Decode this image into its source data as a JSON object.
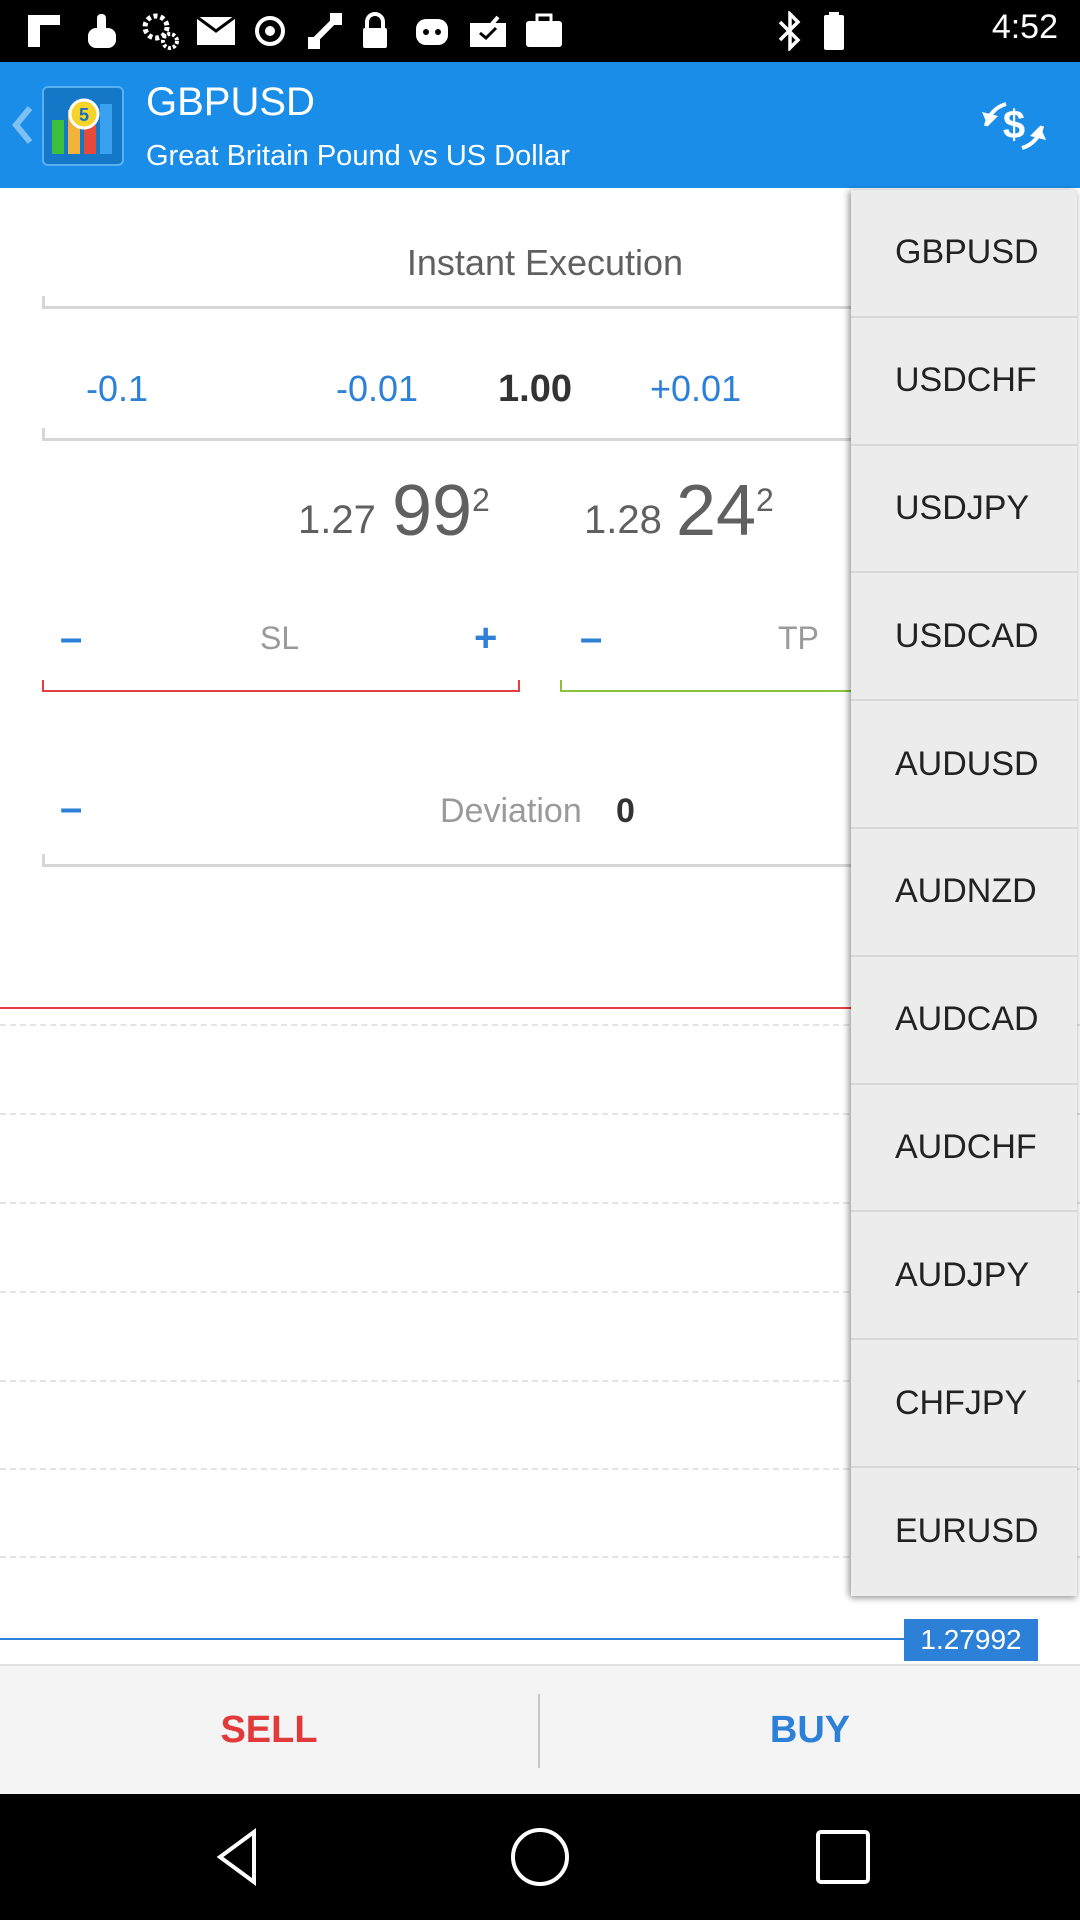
{
  "status_bar": {
    "time": "4:52",
    "icons": [
      "flipboard-icon",
      "touch-icon",
      "gear-icon",
      "mail-icon",
      "gps-icon",
      "fake-gps-icon",
      "lock-icon",
      "android-icon",
      "checkbox-icon",
      "briefcase-icon",
      "bluetooth-icon",
      "battery-icon"
    ]
  },
  "app_bar": {
    "title": "GBPUSD",
    "subtitle": "Great Britain Pound vs US Dollar",
    "back_icon": "chevron-left-icon",
    "action_icon": "currency-exchange-icon"
  },
  "order": {
    "execution_mode": "Instant Execution",
    "volume_steps": {
      "minus_big": "-0.1",
      "minus_small": "-0.01",
      "value": "1.00",
      "plus_small": "+0.01"
    },
    "bid": {
      "prefix": "1.27",
      "main": "99",
      "suffix": "2"
    },
    "ask": {
      "prefix": "1.28",
      "main": "24",
      "suffix": "2"
    },
    "sl": {
      "minus": "–",
      "label": "SL",
      "plus": "+"
    },
    "tp": {
      "minus": "–",
      "label": "TP"
    },
    "deviation": {
      "minus": "–",
      "label": "Deviation",
      "value": "0"
    }
  },
  "symbols": [
    "GBPUSD",
    "USDCHF",
    "USDJPY",
    "USDCAD",
    "AUDUSD",
    "AUDNZD",
    "AUDCAD",
    "AUDCHF",
    "AUDJPY",
    "CHFJPY",
    "EURUSD"
  ],
  "chart": {
    "current_price": "1.27992"
  },
  "actions": {
    "sell": "SELL",
    "buy": "BUY"
  },
  "colors": {
    "accent": "#1a8de8",
    "sell": "#e23a3a",
    "buy": "#2c80d8",
    "tp": "#8ac23a"
  },
  "nav": [
    "back-icon",
    "home-icon",
    "recents-icon"
  ]
}
